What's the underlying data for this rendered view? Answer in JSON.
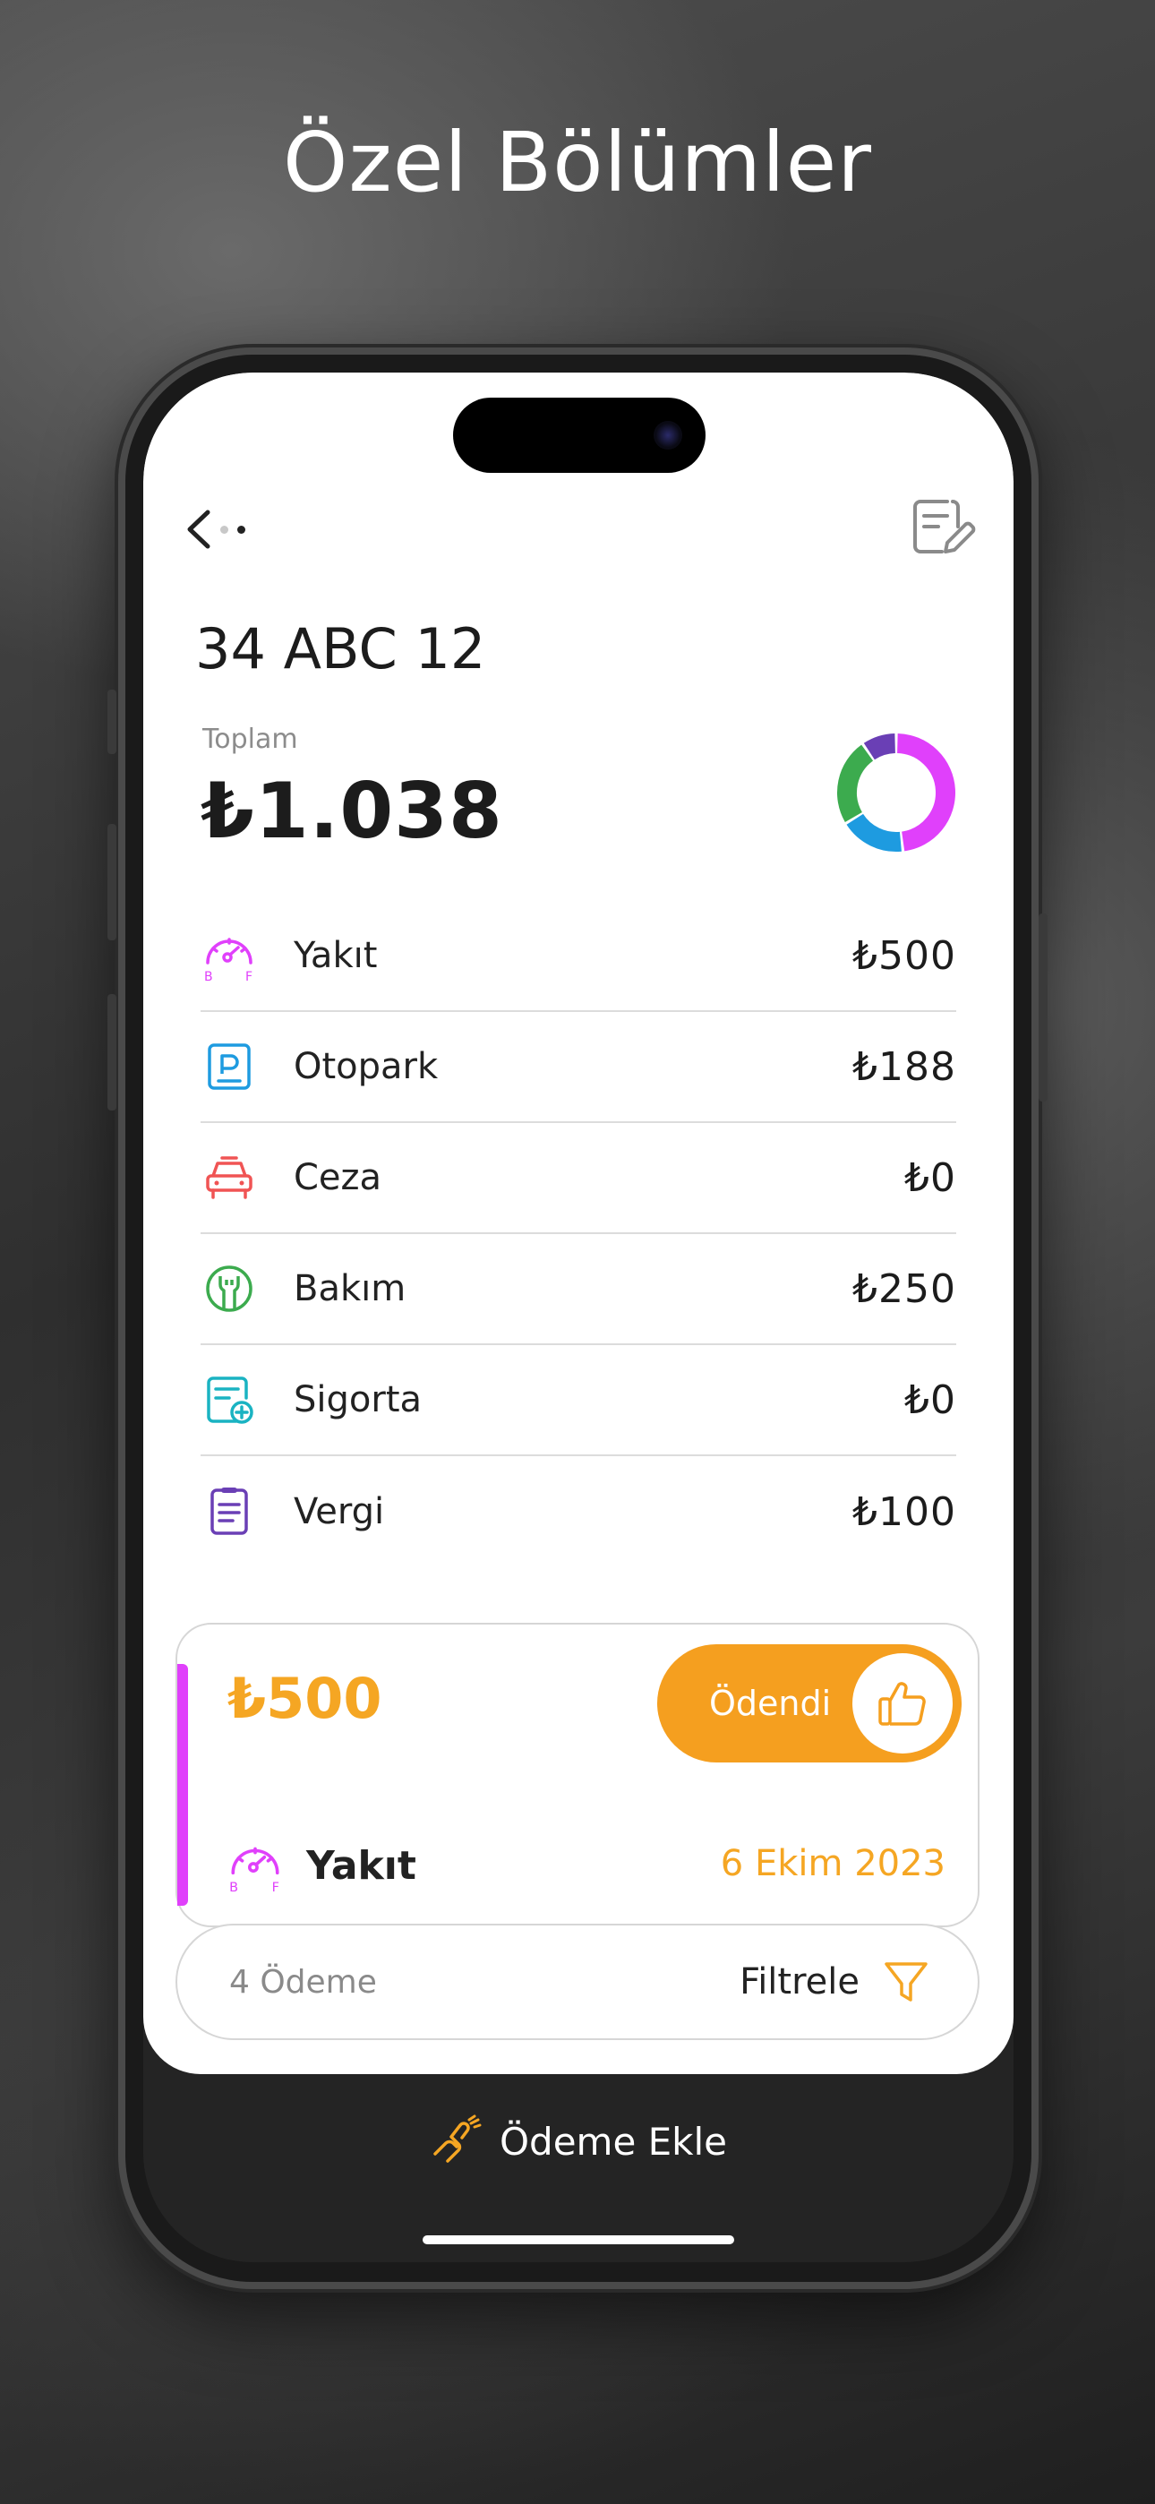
{
  "headline": "Özel Bölümler",
  "header": {
    "back_icon": "chevron-left-icon",
    "edit_icon": "note-edit-icon"
  },
  "vehicle": {
    "plate": "34 ABC 12"
  },
  "summary": {
    "total_label": "Toplam",
    "total_value": "₺1.038"
  },
  "categories": [
    {
      "name": "Yakıt",
      "amount": "₺500",
      "icon": "fuel-gauge-icon",
      "color": "#e040fb",
      "value": 500
    },
    {
      "name": "Otopark",
      "amount": "₺188",
      "icon": "parking-icon",
      "color": "#1e9be0",
      "value": 188
    },
    {
      "name": "Ceza",
      "amount": "₺0",
      "icon": "car-icon",
      "color": "#f05454",
      "value": 0
    },
    {
      "name": "Bakım",
      "amount": "₺250",
      "icon": "wrench-icon",
      "color": "#3cab4e",
      "value": 250
    },
    {
      "name": "Sigorta",
      "amount": "₺0",
      "icon": "insurance-doc-icon",
      "color": "#1ab3c2",
      "value": 0
    },
    {
      "name": "Vergi",
      "amount": "₺100",
      "icon": "tax-doc-icon",
      "color": "#6a3fb5",
      "value": 100
    }
  ],
  "payment": {
    "amount": "₺500",
    "status_label": "Ödendi",
    "status_icon": "thumbs-up-icon",
    "category": "Yakıt",
    "category_icon": "fuel-gauge-icon",
    "date": "6 Ekim 2023",
    "accent": "#e040fb",
    "status_color": "#f59f1f"
  },
  "filter": {
    "count_label": "4 Ödeme",
    "filter_label": "Filtrele",
    "filter_icon": "funnel-icon"
  },
  "footer": {
    "add_label": "Ödeme Ekle",
    "add_icon": "hand-coin-icon"
  }
}
